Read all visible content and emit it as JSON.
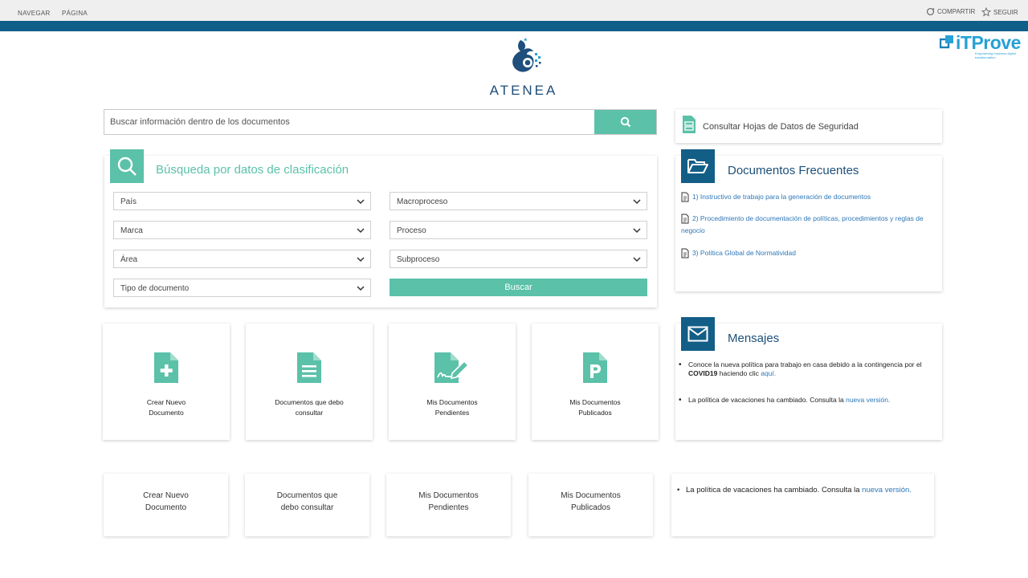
{
  "topbar": {
    "nav_label": "NAVEGAR",
    "page_label": "PÁGINA",
    "share_label": "COMPARTIR",
    "follow_label": "SEGUIR"
  },
  "brand": {
    "logo_text": "ATENEA",
    "partner_logo": "iTProve",
    "partner_tagline": "Empowering business digital transformation"
  },
  "search": {
    "placeholder": "Buscar información dentro de los documentos",
    "button_icon": "search-icon"
  },
  "safety_sheets": {
    "label": "Consultar Hojas de Datos de Seguridad"
  },
  "classification": {
    "title": "Búsqueda por datos de clasificación",
    "filters_left": [
      "País",
      "Marca",
      "Área",
      "Tipo de documento"
    ],
    "filters_right": [
      "Macroproceso",
      "Proceso",
      "Subproceso"
    ],
    "submit_label": "Buscar"
  },
  "frequent": {
    "title": "Documentos Frecuentes",
    "items": [
      "1) Instructivo de trabajo para la generación de documentos",
      "2) Procedimiento de documentación de políticas, procedimientos y reglas de negocio",
      "3) Política Global de Normatividad"
    ]
  },
  "tiles": [
    {
      "line1": "Crear Nuevo",
      "line2": "Documento",
      "icon": "file-plus-icon"
    },
    {
      "line1": "Documentos que debo",
      "line2": "consultar",
      "icon": "file-text-icon"
    },
    {
      "line1": "Mis Documentos",
      "line2": "Pendientes",
      "icon": "file-signature-icon"
    },
    {
      "line1": "Mis Documentos",
      "line2": "Publicados",
      "icon": "file-p-icon"
    }
  ],
  "messages": {
    "title": "Mensajes",
    "msg1_pre": "Conoce la nueva política para trabajo en casa debido a la contingencia por el ",
    "msg1_bold": "COVID19",
    "msg1_mid": " haciendo clic ",
    "msg1_link": "aquí.",
    "msg2_pre": "La política de vacaciones ha cambiado. Consulta la ",
    "msg2_link": "nueva versión."
  },
  "ghost_tiles": [
    {
      "line1": "Crear Nuevo",
      "line2": "Documento"
    },
    {
      "line1": "Documentos que",
      "line2": "debo consultar"
    },
    {
      "line1": "Mis Documentos",
      "line2": "Pendientes"
    },
    {
      "line1": "Mis Documentos",
      "line2": "Publicados"
    }
  ],
  "ghost_message": {
    "pre": "La política de vacaciones ha cambiado. Consulta la ",
    "link": "nueva versión."
  },
  "colors": {
    "teal": "#5bc1a9",
    "navy": "#135e87",
    "link": "#2d77b8",
    "bar": "#0f5f88"
  }
}
